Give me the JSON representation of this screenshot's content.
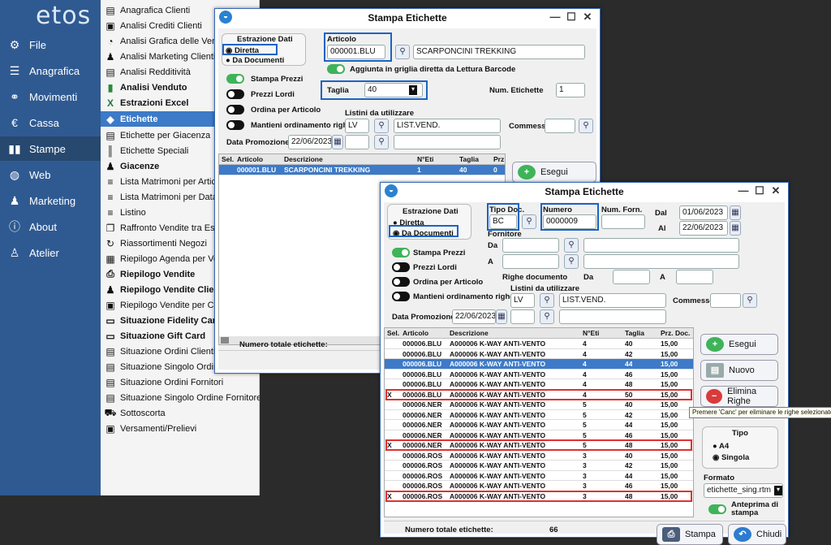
{
  "app": {
    "logo": "etos"
  },
  "nav": [
    {
      "label": "File",
      "icon": "gear-icon"
    },
    {
      "label": "Anagrafica",
      "icon": "database-icon"
    },
    {
      "label": "Movimenti",
      "icon": "users-icon"
    },
    {
      "label": "Cassa",
      "icon": "euro-icon"
    },
    {
      "label": "Stampe",
      "icon": "bar-chart-icon"
    },
    {
      "label": "Web",
      "icon": "globe-icon"
    },
    {
      "label": "Marketing",
      "icon": "group-icon"
    },
    {
      "label": "About",
      "icon": "info-icon"
    },
    {
      "label": "Atelier",
      "icon": "figure-icon"
    }
  ],
  "menu": [
    "Anagrafica Clienti",
    "Analisi Crediti Clienti",
    "Analisi Grafica delle Vendi",
    "Analisi Marketing Clienti",
    "Analisi Redditività",
    "Analisi Venduto",
    "Estrazioni Excel",
    "Etichette",
    "Etichette per Giacenza",
    "Etichette Speciali",
    "Giacenze",
    "Lista Matrimoni per Articol",
    "Lista Matrimoni per Data c",
    "Listino",
    "Raffronto Vendite tra Eserc",
    "Riassortimenti Negozi",
    "Riepilogo Agenda per Vend",
    "Riepilogo Vendite",
    "Riepilogo Vendite Client",
    "Riepilogo Vendite per Con",
    "Situazione Fidelity Card",
    "Situazione Gift Card",
    "Situazione Ordini Clienti",
    "Situazione Singolo Ordine Cliente",
    "Situazione Ordini Fornitori",
    "Situazione Singolo Ordine Fornitore",
    "Sottoscorta",
    "Versamenti/Prelievi"
  ],
  "win1": {
    "title": "Stampa Etichette",
    "estrazione_label": "Estrazione Dati",
    "radio_diretta": "Diretta",
    "radio_documenti": "Da Documenti",
    "articolo_label": "Articolo",
    "articolo_value": "000001.BLU",
    "articolo_desc": "SCARPONCINI TREKKING",
    "aggiunta_label": "Aggiunta in griglia diretta da Lettura Barcode",
    "stampa_prezzi": "Stampa Prezzi",
    "prezzi_lordi": "Prezzi Lordi",
    "ordina": "Ordina per Articolo",
    "mantieni": "Mantieni ordinamento righe",
    "taglia_label": "Taglia",
    "taglia_value": "40",
    "num_etichette_label": "Num. Etichette",
    "num_etichette_value": "1",
    "listini_label": "Listini da utilizzare",
    "listino_code": "LV",
    "listino_desc": "LIST.VEND.",
    "commesso_label": "Commesso",
    "data_promo_label": "Data Promozione",
    "data_promo_value": "22/06/2023",
    "grid_headers": [
      "Sel.",
      "Articolo",
      "Descrizione",
      "N°Eti",
      "Taglia",
      "Prz"
    ],
    "row": {
      "sel": "",
      "articolo": "000001.BLU",
      "descrizione": "SCARPONCINI TREKKING",
      "neti": "1",
      "taglia": "40",
      "prz": "0"
    },
    "esegui": "Esegui",
    "totale_label": "Numero totale etichette:"
  },
  "win2": {
    "title": "Stampa Etichette",
    "estrazione_label": "Estrazione Dati",
    "radio_diretta": "Diretta",
    "radio_documenti": "Da Documenti",
    "tipo_doc_label": "Tipo Doc.",
    "tipo_doc_value": "BC",
    "numero_label": "Numero",
    "numero_value": "0000009",
    "num_forn_label": "Num. Forn.",
    "dal_label": "Dal",
    "dal_value": "01/06/2023",
    "al_label": "Al",
    "al_value": "22/06/2023",
    "fornitore_label": "Fornitore",
    "da_label": "Da",
    "a_label": "A",
    "righe_doc_label": "Righe documento",
    "righe_da": "Da",
    "righe_a": "A",
    "stampa_prezzi": "Stampa Prezzi",
    "prezzi_lordi": "Prezzi Lordi",
    "ordina": "Ordina per Articolo",
    "mantieni": "Mantieni ordinamento righe",
    "listini_label": "Listini da utilizzare",
    "listino_code": "LV",
    "listino_desc": "LIST.VEND.",
    "commesso_label": "Commesso",
    "data_promo_label": "Data Promozione",
    "data_promo_value": "22/06/2023",
    "grid_headers": [
      "Sel.",
      "Articolo",
      "Descrizione",
      "N°Eti",
      "Taglia",
      "Prz. Doc."
    ],
    "rows": [
      {
        "sel": "",
        "art": "000006.BLU",
        "desc": "A000006 K-WAY ANTI-VENTO",
        "n": "4",
        "t": "40",
        "p": "15,00"
      },
      {
        "sel": "",
        "art": "000006.BLU",
        "desc": "A000006 K-WAY ANTI-VENTO",
        "n": "4",
        "t": "42",
        "p": "15,00"
      },
      {
        "sel": "",
        "art": "000006.BLU",
        "desc": "A000006 K-WAY ANTI-VENTO",
        "n": "4",
        "t": "44",
        "p": "15,00"
      },
      {
        "sel": "",
        "art": "000006.BLU",
        "desc": "A000006 K-WAY ANTI-VENTO",
        "n": "4",
        "t": "46",
        "p": "15,00"
      },
      {
        "sel": "",
        "art": "000006.BLU",
        "desc": "A000006 K-WAY ANTI-VENTO",
        "n": "4",
        "t": "48",
        "p": "15,00"
      },
      {
        "sel": "X",
        "art": "000006.BLU",
        "desc": "A000006 K-WAY ANTI-VENTO",
        "n": "4",
        "t": "50",
        "p": "15,00"
      },
      {
        "sel": "",
        "art": "000006.NER",
        "desc": "A000006 K-WAY ANTI-VENTO",
        "n": "5",
        "t": "40",
        "p": "15,00"
      },
      {
        "sel": "",
        "art": "000006.NER",
        "desc": "A000006 K-WAY ANTI-VENTO",
        "n": "5",
        "t": "42",
        "p": "15,00"
      },
      {
        "sel": "",
        "art": "000006.NER",
        "desc": "A000006 K-WAY ANTI-VENTO",
        "n": "5",
        "t": "44",
        "p": "15,00"
      },
      {
        "sel": "",
        "art": "000006.NER",
        "desc": "A000006 K-WAY ANTI-VENTO",
        "n": "5",
        "t": "46",
        "p": "15,00"
      },
      {
        "sel": "X",
        "art": "000006.NER",
        "desc": "A000006 K-WAY ANTI-VENTO",
        "n": "5",
        "t": "48",
        "p": "15,00"
      },
      {
        "sel": "",
        "art": "000006.ROS",
        "desc": "A000006 K-WAY ANTI-VENTO",
        "n": "3",
        "t": "40",
        "p": "15,00"
      },
      {
        "sel": "",
        "art": "000006.ROS",
        "desc": "A000006 K-WAY ANTI-VENTO",
        "n": "3",
        "t": "42",
        "p": "15,00"
      },
      {
        "sel": "",
        "art": "000006.ROS",
        "desc": "A000006 K-WAY ANTI-VENTO",
        "n": "3",
        "t": "44",
        "p": "15,00"
      },
      {
        "sel": "",
        "art": "000006.ROS",
        "desc": "A000006 K-WAY ANTI-VENTO",
        "n": "3",
        "t": "46",
        "p": "15,00"
      },
      {
        "sel": "X",
        "art": "000006.ROS",
        "desc": "A000006 K-WAY ANTI-VENTO",
        "n": "3",
        "t": "48",
        "p": "15,00"
      }
    ],
    "esegui": "Esegui",
    "nuovo": "Nuovo",
    "elimina": "Elimina Righe",
    "tooltip": "Premere 'Canc' per eliminare le righe selezionate.",
    "tipo_label": "Tipo",
    "tipo_a4": "A4",
    "tipo_singola": "Singola",
    "formato_label": "Formato",
    "formato_value": "etichette_sing.rtm",
    "anteprima": "Anteprima di stampa",
    "totale_label": "Numero totale etichette:",
    "totale_value": "66",
    "stampa": "Stampa",
    "chiudi": "Chiudi"
  }
}
